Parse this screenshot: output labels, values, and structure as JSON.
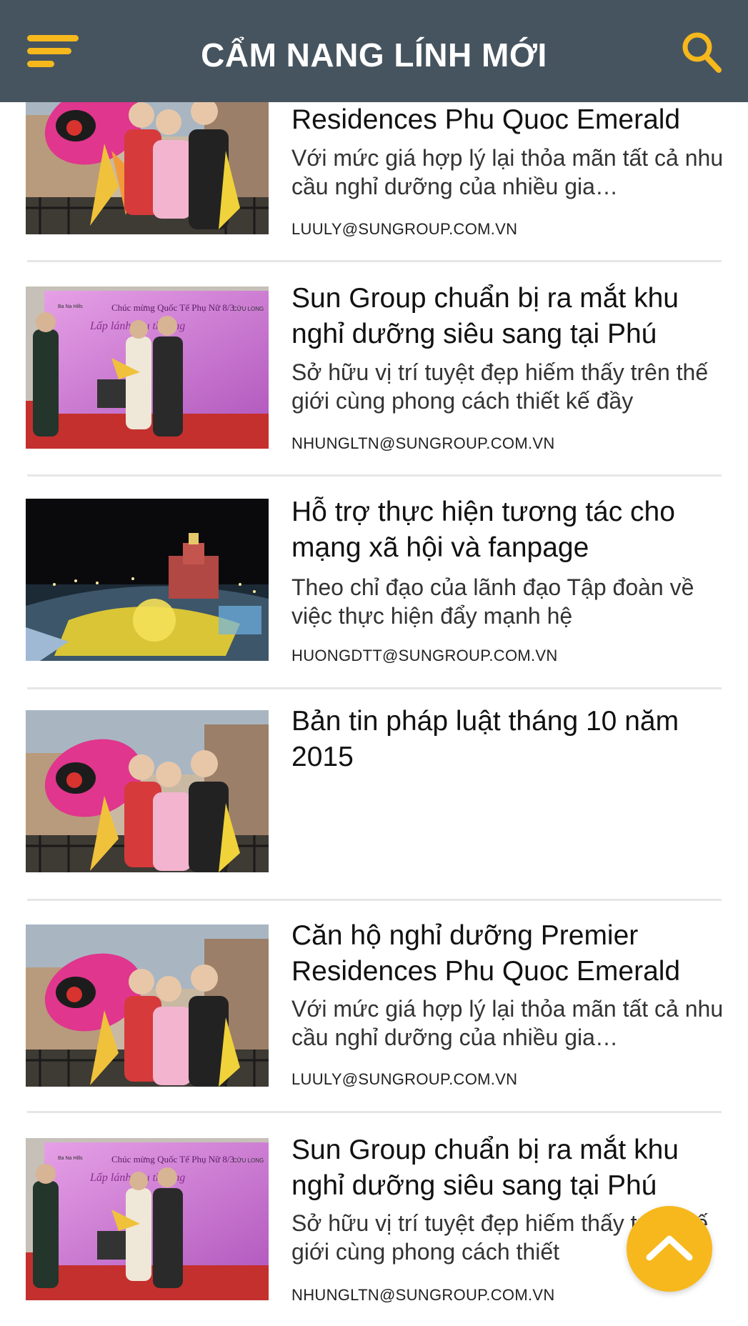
{
  "header": {
    "title": "CẨM NANG LÍNH MỚI",
    "accent_color": "#f6b81c",
    "background_color": "#46545f"
  },
  "icons": {
    "menu": "hamburger-menu-icon",
    "search": "search-icon",
    "scroll_top": "chevron-up-icon"
  },
  "articles": [
    {
      "title": "Residences Phu Quoc Emerald",
      "excerpt": "Với mức giá hợp lý lại thỏa mãn tất cả nhu cầu nghỉ dưỡng của nhiều gia…",
      "author": "LUULY@SUNGROUP.COM.VN",
      "image": "women-with-butterfly-costume"
    },
    {
      "title": "Sun Group chuẩn bị ra mắt khu nghỉ dưỡng siêu sang tại Phú",
      "excerpt": "Sở hữu vị trí tuyệt đẹp hiếm thấy trên thế giới cùng phong cách thiết kế đầy",
      "author": "NHUNGLTN@SUNGROUP.COM.VN",
      "image": "stage-event-pink-backdrop",
      "backdrop_text": [
        "Chúc mừng Quốc Tế Phụ Nữ 8/3",
        "Lấp lánh yêu thương",
        "CỬU LONG",
        "Ba Na Hills"
      ]
    },
    {
      "title": "Hỗ trợ thực hiện tương tác cho mạng xã hội và fanpage",
      "excerpt": "Theo chỉ đạo của lãnh đạo Tập đoàn về việc thực hiện đẩy mạnh hệ",
      "author": "HUONGDTT@SUNGROUP.COM.VN",
      "image": "night-resort-aerial"
    },
    {
      "title": "Bản tin pháp luật tháng 10 năm 2015",
      "excerpt": "",
      "author": "",
      "image": "women-with-butterfly-costume"
    },
    {
      "title": "Căn hộ nghỉ dưỡng Premier Residences Phu Quoc Emerald",
      "excerpt": "Với mức giá hợp lý lại thỏa mãn tất cả nhu cầu nghỉ dưỡng của nhiều gia…",
      "author": "LUULY@SUNGROUP.COM.VN",
      "image": "women-with-butterfly-costume"
    },
    {
      "title": "Sun Group chuẩn bị ra mắt khu nghỉ dưỡng siêu sang tại Phú",
      "excerpt": "Sở hữu vị trí tuyệt đẹp hiếm thấy trên thế giới cùng phong cách thiết",
      "author": "NHUNGLTN@SUNGROUP.COM.VN",
      "image": "stage-event-pink-backdrop",
      "backdrop_text": [
        "Chúc mừng Quốc Tế Phụ Nữ 8/3",
        "Lấp lánh yêu thương",
        "CỬU LONG",
        "Ba Na Hills"
      ]
    }
  ]
}
